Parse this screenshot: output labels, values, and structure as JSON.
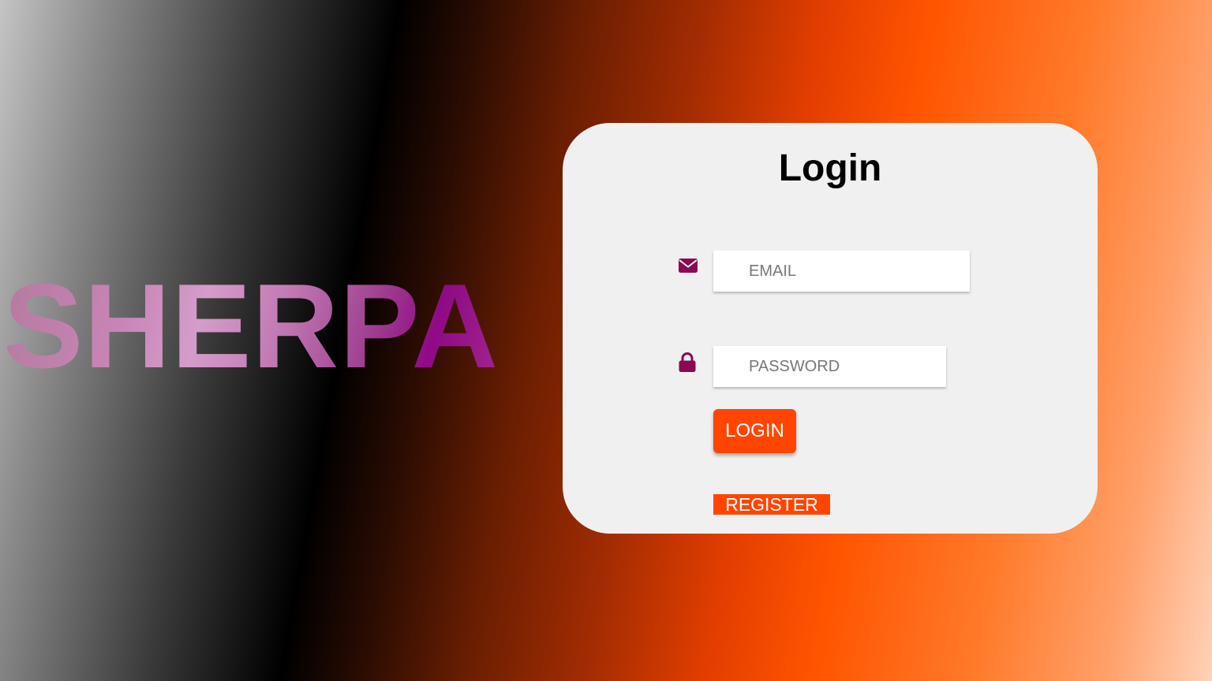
{
  "brand": {
    "title": "SHERPA"
  },
  "login_card": {
    "heading": "Login",
    "email": {
      "icon": "envelope-icon",
      "placeholder": "EMAIL",
      "value": ""
    },
    "password": {
      "icon": "lock-icon",
      "placeholder": "PASSWORD",
      "value": ""
    },
    "login_label": "LOGIN",
    "register_label": "REGISTER"
  },
  "colors": {
    "accent": "#ff4500",
    "icon": "#8a0a52",
    "card_background": "#f0f0f0",
    "brand_gradient": [
      "#b57a9e",
      "#d59ccb",
      "#8f0a86"
    ]
  }
}
